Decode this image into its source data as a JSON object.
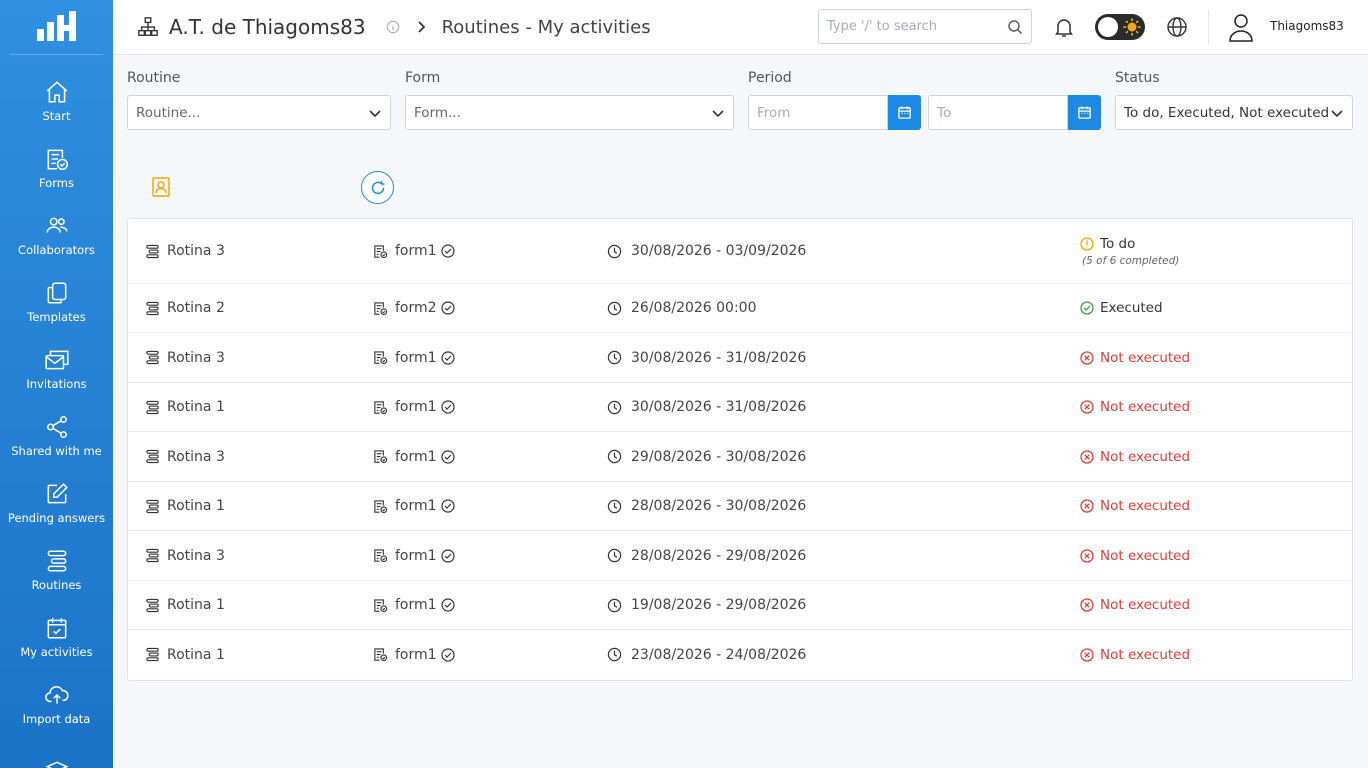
{
  "colors": {
    "sidebar": "#1e7fd6",
    "accent": "#1e88e5",
    "todo": "#f0a500",
    "executed": "#43a047",
    "not_executed": "#e53935"
  },
  "sidebar": {
    "items": [
      {
        "label": "Start",
        "icon": "home-icon"
      },
      {
        "label": "Forms",
        "icon": "form-check-icon"
      },
      {
        "label": "Collaborators",
        "icon": "users-icon"
      },
      {
        "label": "Templates",
        "icon": "copy-icon"
      },
      {
        "label": "Invitations",
        "icon": "mail-icon"
      },
      {
        "label": "Shared with me",
        "icon": "share-icon"
      },
      {
        "label": "Pending answers",
        "icon": "edit-icon"
      },
      {
        "label": "Routines",
        "icon": "routine-list-icon"
      },
      {
        "label": "My activities",
        "icon": "calendar-check-icon"
      },
      {
        "label": "Import data",
        "icon": "cloud-upload-icon"
      }
    ]
  },
  "header": {
    "org_name": "A.T. de Thiagoms83",
    "page_title": "Routines - My activities",
    "search_placeholder": "Type '/' to search",
    "username": "Thiagoms83"
  },
  "filters": {
    "routine": {
      "label": "Routine",
      "value": "Routine..."
    },
    "form": {
      "label": "Form",
      "value": "Form..."
    },
    "period": {
      "label": "Period",
      "from_placeholder": "From",
      "to_placeholder": "To"
    },
    "status": {
      "label": "Status",
      "value": "To do, Executed, Not executed"
    }
  },
  "rows": [
    {
      "routine": "Rotina 3",
      "form": "form1",
      "period": "30/08/2026 - 03/09/2026",
      "status": "To do",
      "status_type": "todo",
      "sub": "(5 of 6 completed)"
    },
    {
      "routine": "Rotina 2",
      "form": "form2",
      "period": "26/08/2026 00:00",
      "status": "Executed",
      "status_type": "executed",
      "sub": ""
    },
    {
      "routine": "Rotina 3",
      "form": "form1",
      "period": "30/08/2026 - 31/08/2026",
      "status": "Not executed",
      "status_type": "not",
      "sub": ""
    },
    {
      "routine": "Rotina 1",
      "form": "form1",
      "period": "30/08/2026 - 31/08/2026",
      "status": "Not executed",
      "status_type": "not",
      "sub": ""
    },
    {
      "routine": "Rotina 3",
      "form": "form1",
      "period": "29/08/2026 - 30/08/2026",
      "status": "Not executed",
      "status_type": "not",
      "sub": ""
    },
    {
      "routine": "Rotina 1",
      "form": "form1",
      "period": "28/08/2026 - 30/08/2026",
      "status": "Not executed",
      "status_type": "not",
      "sub": ""
    },
    {
      "routine": "Rotina 3",
      "form": "form1",
      "period": "28/08/2026 - 29/08/2026",
      "status": "Not executed",
      "status_type": "not",
      "sub": ""
    },
    {
      "routine": "Rotina 1",
      "form": "form1",
      "period": "19/08/2026 - 29/08/2026",
      "status": "Not executed",
      "status_type": "not",
      "sub": ""
    },
    {
      "routine": "Rotina 1",
      "form": "form1",
      "period": "23/08/2026 - 24/08/2026",
      "status": "Not executed",
      "status_type": "not",
      "sub": ""
    }
  ]
}
